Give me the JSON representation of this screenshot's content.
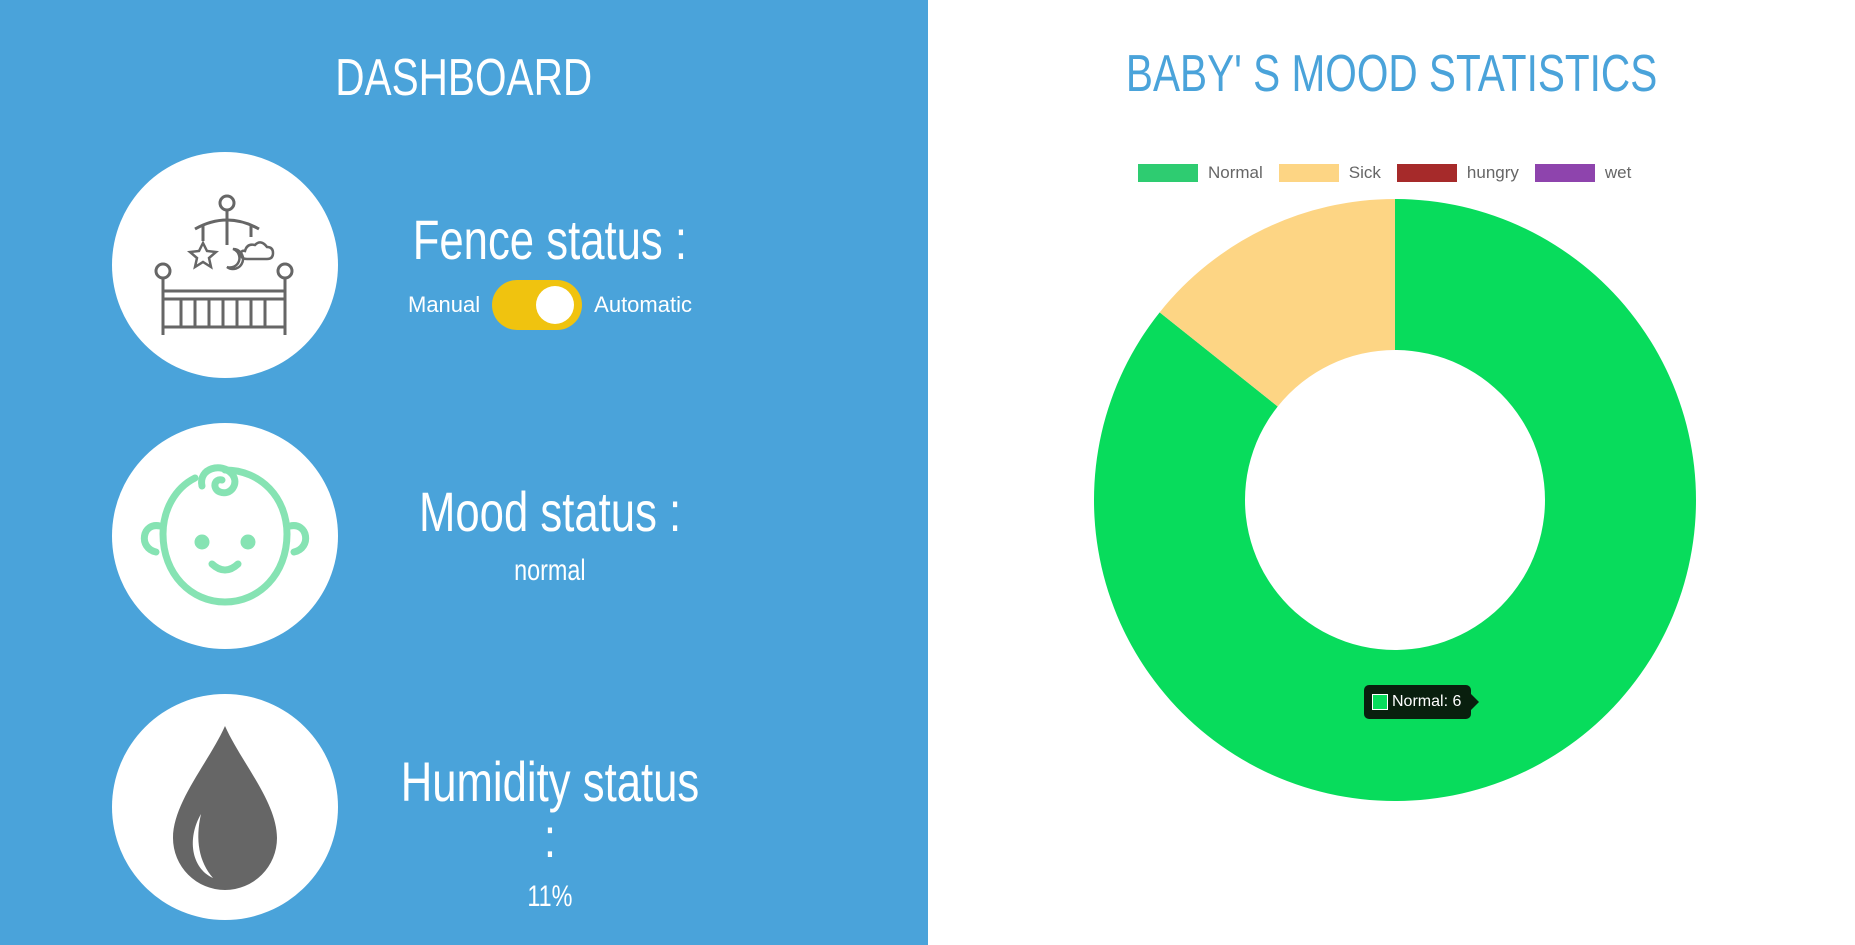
{
  "dashboard": {
    "title": "DASHBOARD",
    "fence": {
      "title": "Fence status :",
      "left_label": "Manual",
      "right_label": "Automatic",
      "icon": "crib-icon"
    },
    "mood": {
      "title": "Mood status :",
      "value": "normal",
      "icon": "baby-face-icon"
    },
    "humidity": {
      "title": "Humidity status :",
      "value": "11%",
      "icon": "water-drop-icon"
    }
  },
  "colors": {
    "panel": "#4aa3da",
    "toggle": "#f0c30f",
    "normal": "#08dc5c",
    "sick": "#fdd584",
    "hungry": "#a62a2a",
    "wet": "#8e44ad"
  },
  "tooltip": {
    "label": "Normal: 6"
  },
  "chart_data": {
    "type": "pie",
    "title": "BABY' S MOOD STATISTICS",
    "legend_position": "top",
    "categories": [
      "Normal",
      "Sick",
      "hungry",
      "wet"
    ],
    "values": [
      6,
      1,
      0,
      0
    ],
    "legend_colors": [
      "#2ecc71",
      "#fdd584",
      "#a62a2a",
      "#8e44ad"
    ],
    "slice_colors": [
      "#08dc5c",
      "#fdd584",
      "#a62a2a",
      "#8e44ad"
    ]
  }
}
